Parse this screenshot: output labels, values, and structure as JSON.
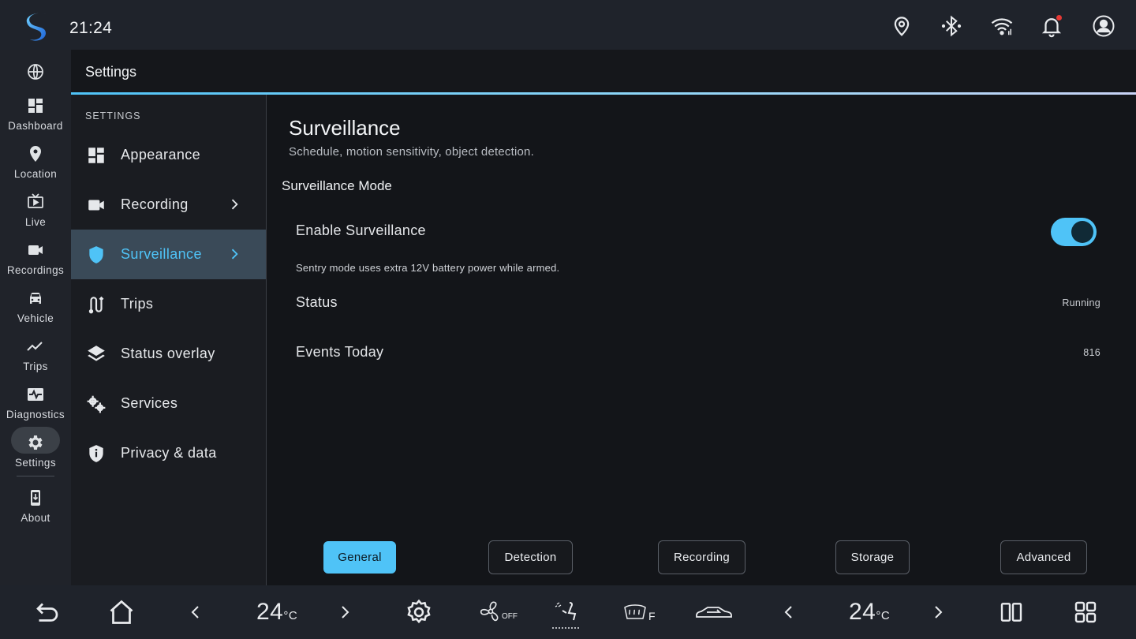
{
  "status_bar": {
    "time": "21:24",
    "icons": [
      "location-pin-icon",
      "bluetooth-icon",
      "wifi-icon",
      "notification-bell-icon",
      "account-icon"
    ],
    "notification_dot_color": "#e53935"
  },
  "rail": {
    "items": [
      {
        "icon": "globe-icon",
        "label": ""
      },
      {
        "icon": "dashboard-icon",
        "label": "Dashboard"
      },
      {
        "icon": "location-icon",
        "label": "Location"
      },
      {
        "icon": "live-tv-icon",
        "label": "Live"
      },
      {
        "icon": "video-camera-icon",
        "label": "Recordings"
      },
      {
        "icon": "car-icon",
        "label": "Vehicle"
      },
      {
        "icon": "trend-line-icon",
        "label": "Trips"
      },
      {
        "icon": "heartbeat-monitor-icon",
        "label": "Diagnostics"
      },
      {
        "icon": "gear-icon",
        "label": "Settings",
        "active": true
      },
      {
        "icon": "phone-download-icon",
        "label": "About"
      }
    ]
  },
  "header": {
    "title": "Settings"
  },
  "menu": {
    "heading": "SETTINGS",
    "items": [
      {
        "icon": "grid-icon",
        "label": "Appearance",
        "chevron": false
      },
      {
        "icon": "video-camera-icon",
        "label": "Recording",
        "chevron": true
      },
      {
        "icon": "shield-icon",
        "label": "Surveillance",
        "chevron": true,
        "active": true
      },
      {
        "icon": "route-icon",
        "label": "Trips",
        "chevron": false
      },
      {
        "icon": "layers-icon",
        "label": "Status overlay",
        "chevron": false
      },
      {
        "icon": "cogs-icon",
        "label": "Services",
        "chevron": false
      },
      {
        "icon": "privacy-shield-icon",
        "label": "Privacy & data",
        "chevron": false
      }
    ]
  },
  "content": {
    "title": "Surveillance",
    "subtitle": "Schedule, motion sensitivity, object detection.",
    "section": "Surveillance Mode",
    "enable_label": "Enable Surveillance",
    "enable_on": true,
    "note": "Sentry mode uses extra 12V battery power while armed.",
    "status_label": "Status",
    "status_value": "Running",
    "events_label": "Events Today",
    "events_value": "816",
    "tabs": [
      "General",
      "Detection",
      "Recording",
      "Storage",
      "Advanced"
    ],
    "selected_tab": "General"
  },
  "bottom_bar": {
    "left_temp": "24",
    "right_temp": "24",
    "temp_unit": "°C",
    "fan_label": "OFF",
    "defrost_label": "F",
    "icons": [
      "back-icon",
      "home-icon",
      "chevron-left-icon",
      "chevron-right-icon",
      "settings-gear-icon",
      "fan-icon",
      "seat-airflow-icon",
      "rear-defrost-icon",
      "car-recirculation-icon",
      "split-screen-icon",
      "app-grid-icon"
    ]
  },
  "colors": {
    "accent": "#4fc3f7",
    "active_menu_bg": "#3a4a58",
    "background": "#14161a"
  }
}
